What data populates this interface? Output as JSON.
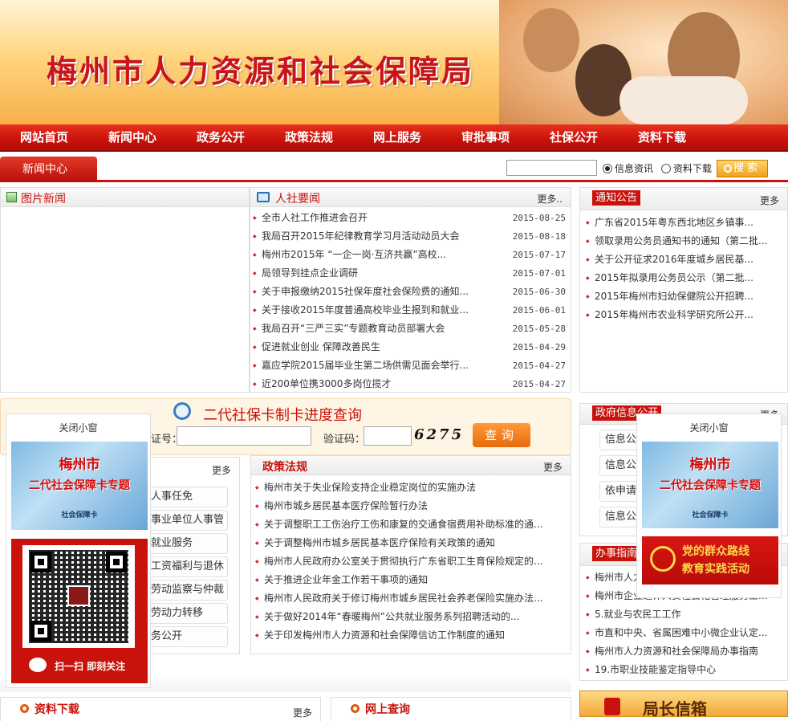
{
  "site": {
    "title": "梅州市人力资源和社会保障局"
  },
  "nav": [
    "网站首页",
    "新闻中心",
    "政务公开",
    "政策法规",
    "网上服务",
    "审批事项",
    "社保公开",
    "资料下载"
  ],
  "subbar": {
    "current": "新闻中心",
    "search_placeholder": "",
    "radio_info": "信息资讯",
    "radio_download": "资料下载",
    "search_button": "搜索"
  },
  "photo_news": {
    "title": "图片新闻"
  },
  "hr_news": {
    "title": "人社要闻",
    "more": "更多..",
    "items": [
      {
        "title": "全市人社工作推进会召开",
        "date": "2015-08-25"
      },
      {
        "title": "我局召开2015年纪律教育学习月活动动员大会",
        "date": "2015-08-18"
      },
      {
        "title": "梅州市2015年 “一企一岗·互济共赢”高校...",
        "date": "2015-07-17"
      },
      {
        "title": "局领导到挂点企业调研",
        "date": "2015-07-01"
      },
      {
        "title": "关于申报缴纳2015社保年度社会保险费的通知...",
        "date": "2015-06-30"
      },
      {
        "title": "关于接收2015年度普通高校毕业生报到和就业...",
        "date": "2015-06-01"
      },
      {
        "title": "我局召开“三严三实”专题教育动员部署大会",
        "date": "2015-05-28"
      },
      {
        "title": "促进就业创业 保障改善民生",
        "date": "2015-04-29"
      },
      {
        "title": "嘉应学院2015届毕业生第二场供需见面会举行...",
        "date": "2015-04-27"
      },
      {
        "title": "近200单位携3000多岗位揽才",
        "date": "2015-04-27"
      }
    ]
  },
  "notice": {
    "title": "通知公告",
    "more": "更多",
    "items": [
      "广东省2015年粤东西北地区乡镇事...",
      "领取录用公务员通知书的通知（第二批...",
      "关于公开征求2016年度城乡居民基...",
      "2015年拟录用公务员公示（第二批...",
      "2015年梅州市妇幼保健院公开招聘...",
      "2015年梅州市农业科学研究所公开..."
    ]
  },
  "query": {
    "title": "二代社保卡制卡进度查询",
    "id_label": "证号：",
    "code_label": "验证码：",
    "captcha": "6275",
    "button": "查询"
  },
  "personnel": {
    "more": "更多",
    "items": [
      "人事任免",
      "事业单位人事管理",
      "就业服务",
      "工资福利与退休",
      "劳动监察与仲裁",
      "劳动力转移",
      "务公开"
    ]
  },
  "policy": {
    "title": "政策法规",
    "more": "更多",
    "items": [
      "梅州市关于失业保险支持企业稳定岗位的实施办法",
      "梅州市城乡居民基本医疗保险暂行办法",
      "关于调整职工工伤治疗工伤和康复的交通食宿费用补助标准的通...",
      "关于调整梅州市城乡居民基本医疗保险有关政策的通知",
      "梅州市人民政府办公室关于贯彻执行广东省职工生育保险规定的...",
      "关于推进企业年金工作若干事项的通知",
      "梅州市人民政府关于修订梅州市城乡居民社会养老保险实施办法...",
      "关于做好2014年“春暖梅州”公共就业服务系列招聘活动的...",
      "关于印发梅州市人力资源和社会保障信访工作制度的通知"
    ]
  },
  "gov_info": {
    "title": "政府信息公开",
    "more": "更多",
    "items": [
      "信息公",
      "信息公",
      "依申请",
      "信息公"
    ]
  },
  "affairs": {
    "title": "办事指南",
    "items": [
      "梅州市人力",
      "梅州市企业退休人员社会化管理服务工...",
      "5.就业与农民工工作",
      "市直和中央、省属困难中小微企业认定...",
      "梅州市人力资源和社会保障局办事指南",
      "19.市职业技能鉴定指导中心"
    ]
  },
  "bottom": {
    "downloads": "资料下载",
    "downloads_more": "更多",
    "online_query": "网上查询",
    "director_mail": "局长信箱"
  },
  "float_left": {
    "close": "关闭小窗",
    "card_line1": "梅州市",
    "card_line2": "二代社会保障卡专题",
    "card_small": "社会保障卡",
    "qr_caption": "扫一扫 即刻关注"
  },
  "float_right": {
    "close": "关闭小窗",
    "card_line1": "梅州市",
    "card_line2": "二代社会保障卡专题",
    "card_small": "社会保障卡",
    "mass_line1": "党的群众路线",
    "mass_line2": "教育实践活动"
  },
  "colors": {
    "brand_red": "#c9120b",
    "accent_orange": "#f0a11e"
  }
}
